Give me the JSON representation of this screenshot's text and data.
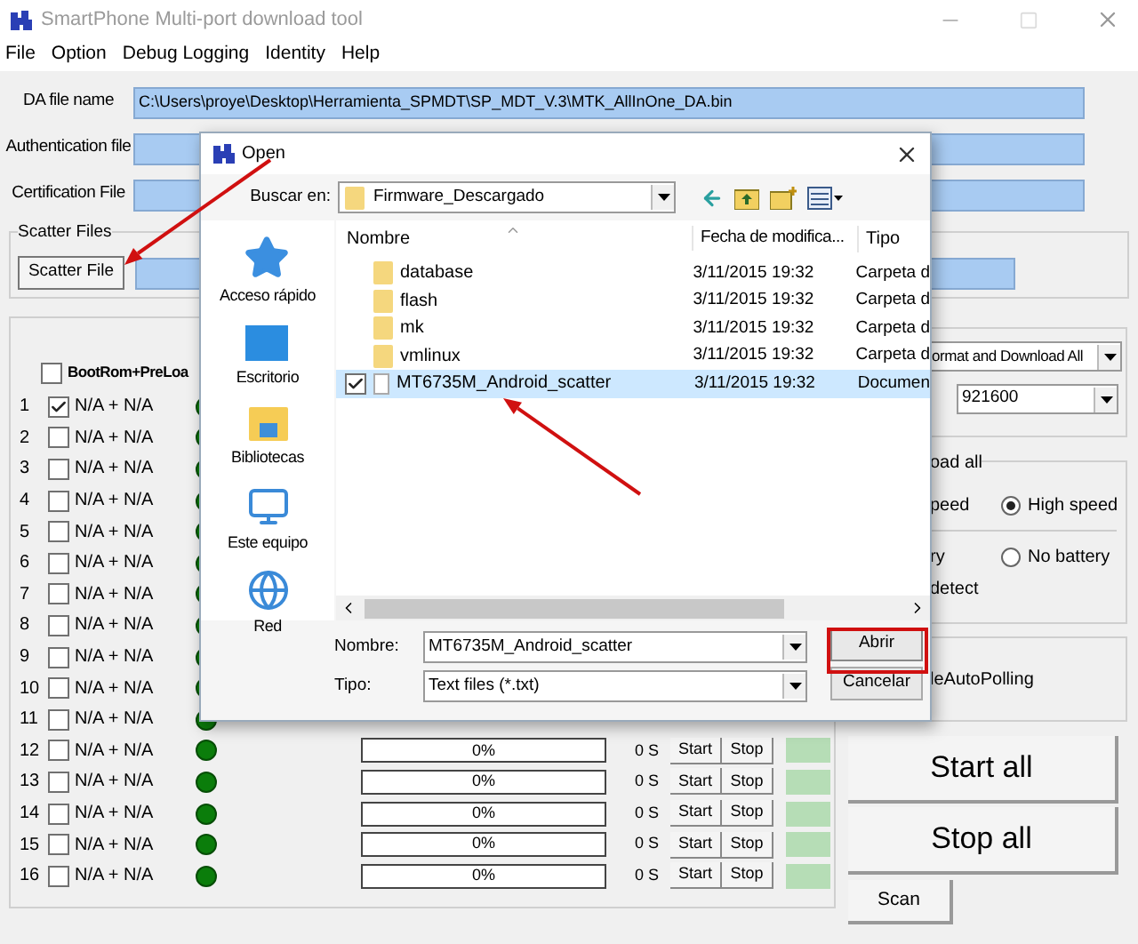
{
  "window": {
    "title": "SmartPhone Multi-port download tool"
  },
  "menu": [
    "File",
    "Option",
    "Debug Logging",
    "Identity",
    "Help"
  ],
  "fields": [
    {
      "label": "DA file name",
      "value": "C:\\Users\\proye\\Desktop\\Herramienta_SPMDT\\SP_MDT_V.3\\MTK_AllInOne_DA.bin"
    },
    {
      "label": "Authentication file"
    },
    {
      "label": "Certification File"
    }
  ],
  "scatter": {
    "group_title": "Scatter Files",
    "button": "Scatter File"
  },
  "ports": {
    "header_label": "BootRom+PreLoa",
    "header_checked": false,
    "rows": [
      {
        "kind": "covered",
        "number": "1",
        "checked": true,
        "label": "N/A + N/A"
      },
      {
        "kind": "covered",
        "number": "2",
        "checked": false,
        "label": "N/A + N/A"
      },
      {
        "kind": "covered",
        "number": "3",
        "checked": false,
        "label": "N/A + N/A"
      },
      {
        "kind": "covered",
        "number": "4",
        "checked": false,
        "label": "N/A + N/A"
      },
      {
        "kind": "covered",
        "number": "5",
        "checked": false,
        "label": "N/A + N/A"
      },
      {
        "kind": "covered",
        "number": "6",
        "checked": false,
        "label": "N/A + N/A"
      },
      {
        "kind": "covered",
        "number": "7",
        "checked": false,
        "label": "N/A + N/A"
      },
      {
        "kind": "covered",
        "number": "8",
        "checked": false,
        "label": "N/A + N/A"
      },
      {
        "kind": "covered",
        "number": "9",
        "checked": false,
        "label": "N/A + N/A"
      },
      {
        "kind": "covered",
        "number": "10",
        "checked": false,
        "label": "N/A + N/A"
      },
      {
        "kind": "covered",
        "number": "11",
        "checked": false,
        "label": "N/A + N/A"
      },
      {
        "kind": "full",
        "number": "12",
        "checked": false,
        "label": "N/A + N/A",
        "progress": "0%",
        "level": 0,
        "time": "0 S",
        "start": "Start",
        "stop": "Stop"
      },
      {
        "kind": "full",
        "number": "13",
        "checked": false,
        "label": "N/A + N/A",
        "progress": "0%",
        "level": 0,
        "time": "0 S",
        "start": "Start",
        "stop": "Stop"
      },
      {
        "kind": "full",
        "number": "14",
        "checked": false,
        "label": "N/A + N/A",
        "progress": "0%",
        "level": 0,
        "time": "0 S",
        "start": "Start",
        "stop": "Stop"
      },
      {
        "kind": "full",
        "number": "15",
        "checked": false,
        "label": "N/A + N/A",
        "progress": "0%",
        "level": 0,
        "time": "0 S",
        "start": "Start",
        "stop": "Stop"
      },
      {
        "kind": "full",
        "number": "16",
        "checked": false,
        "label": "N/A + N/A",
        "progress": "0%",
        "level": 0,
        "time": "0 S",
        "start": "Start",
        "stop": "Stop"
      }
    ]
  },
  "options": {
    "mode": "ormat and Download All",
    "baud": "921600",
    "group_title": "oad all",
    "speed_text": "peed",
    "battery_text": "ry",
    "detect_text": "detect",
    "polling_text": "leAutoPolling",
    "radios": [
      {
        "label": "High speed",
        "selected": true
      },
      {
        "label": "No battery",
        "selected": false
      }
    ]
  },
  "actions": {
    "start_all": "Start all",
    "stop_all": "Stop all",
    "scan": "Scan"
  },
  "dialog": {
    "title": "Open",
    "look_in_label": "Buscar en:",
    "look_in": "Firmware_Descargado",
    "places": [
      {
        "kind": "star",
        "label": "Acceso rápido"
      },
      {
        "kind": "desktop",
        "label": "Escritorio"
      },
      {
        "kind": "library",
        "label": "Bibliotecas"
      },
      {
        "kind": "computer",
        "label": "Este equipo"
      },
      {
        "kind": "network",
        "label": "Red"
      }
    ],
    "columns": [
      "Nombre",
      "Fecha de modifica...",
      "Tipo"
    ],
    "files": [
      {
        "kind": "folder",
        "name": "database",
        "date": "3/11/2015 19:32",
        "type": "Carpeta d",
        "selected": false
      },
      {
        "kind": "folder",
        "name": "flash",
        "date": "3/11/2015 19:32",
        "type": "Carpeta d",
        "selected": false
      },
      {
        "kind": "folder",
        "name": "mk",
        "date": "3/11/2015 19:32",
        "type": "Carpeta d",
        "selected": false
      },
      {
        "kind": "folder",
        "name": "vmlinux",
        "date": "3/11/2015 19:32",
        "type": "Carpeta d",
        "selected": false
      },
      {
        "kind": "file",
        "name": "MT6735M_Android_scatter",
        "date": "3/11/2015 19:32",
        "type": "Documen",
        "selected": true
      }
    ],
    "name_label": "Nombre:",
    "name_value": "MT6735M_Android_scatter",
    "type_label": "Tipo:",
    "type_value": "Text files (*.txt)",
    "open_button": "Abrir",
    "cancel_button": "Cancelar"
  }
}
